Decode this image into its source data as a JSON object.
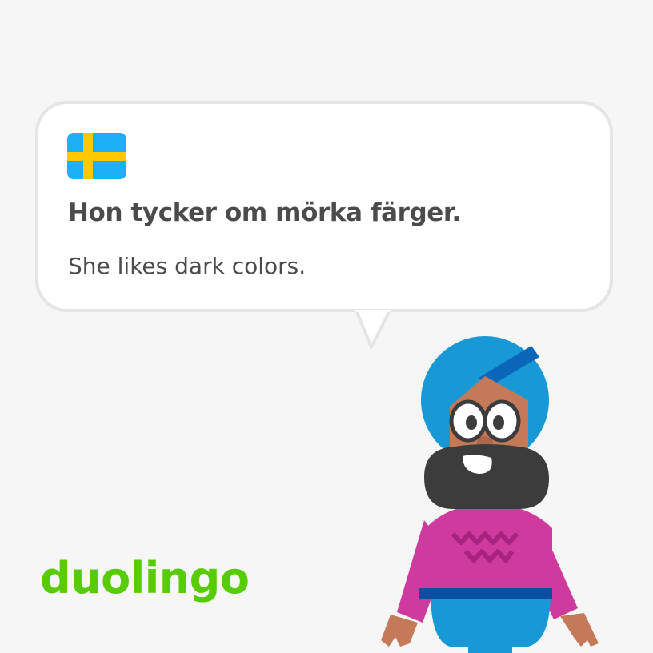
{
  "card": {
    "flag_icon": "sweden-flag-icon",
    "sentence": "Hon tycker om mörka färger.",
    "translation": "She likes dark colors."
  },
  "brand": {
    "logo_text": "duolingo",
    "logo_color": "#58cc02"
  },
  "character": {
    "icon": "duolingo-character-icon"
  },
  "colors": {
    "background": "#f6f6f7",
    "bubble_border": "#e5e5e5",
    "text": "#4b4b4b",
    "flag_blue": "#1cb0f6",
    "flag_yellow": "#ffc800"
  }
}
